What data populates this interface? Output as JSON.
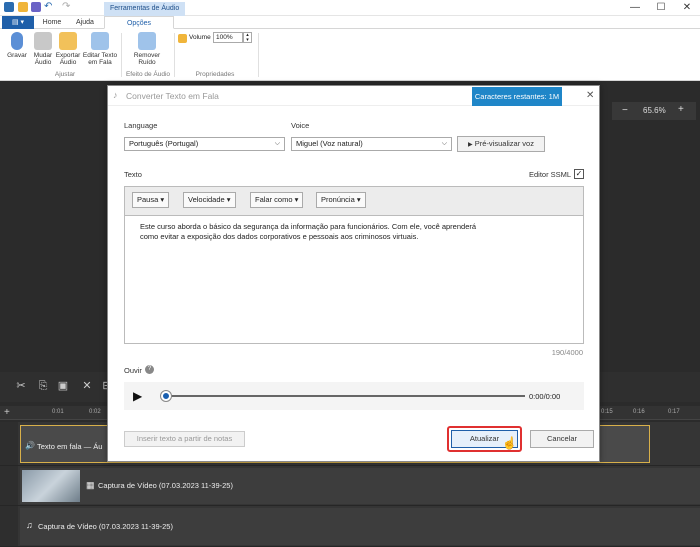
{
  "titlebar": {
    "contextual_tab": "Ferramentas de Áudio",
    "window_controls": [
      "—",
      "☐",
      "✕"
    ]
  },
  "ribbon_tabs": [
    "Home",
    "Ajuda",
    "Opções"
  ],
  "ribbon": {
    "adjust_buttons": [
      {
        "label_1": "Gravar",
        "label_2": "",
        "icon": "microphone-icon"
      },
      {
        "label_1": "Mudar",
        "label_2": "Áudio",
        "icon": "speaker-icon"
      },
      {
        "label_1": "Exportar",
        "label_2": "Áudio",
        "icon": "export-audio-icon"
      },
      {
        "label_1": "Editar Texto",
        "label_2": "em Fala",
        "icon": "edit-tts-icon"
      }
    ],
    "adjust_group_label": "Ajustar",
    "noise_button": {
      "label_1": "Remover",
      "label_2": "Ruído"
    },
    "effect_group_label": "Efeito de Áudio",
    "volume_label": "Volume",
    "volume_value": "100%",
    "properties_group_label": "Propriedades"
  },
  "preview": {
    "zoom_minus": "−",
    "zoom_value": "65.6%",
    "zoom_plus": "+"
  },
  "dialog": {
    "title": "Converter Texto em Fala",
    "chars_remaining": "Caracteres restantes: 1M",
    "close": "✕",
    "language_label": "Language",
    "language_value": "Português (Portugal)",
    "voice_label": "Voice",
    "voice_value": "Miguel (Voz natural)",
    "preview_voice_button": "Pré-visualizar voz",
    "text_label": "Texto",
    "ssml_label": "Editor SSML",
    "ssml_checked": true,
    "editor_buttons": [
      "Pausa",
      "Velocidade",
      "Falar como",
      "Pronúncia"
    ],
    "text_line_1": "Este curso aborda o básico da segurança da informação para funcionários. Com ele, você aprenderá",
    "text_line_2": "como evitar a exposição dos dados corporativos e pessoais aos criminosos virtuais.",
    "char_count": "190/4000",
    "listen_label": "Ouvir",
    "time_display": "0:00/0:00",
    "insert_notes_button": "Inserir texto a partir de notas",
    "update_button": "Atualizar",
    "cancel_button": "Cancelar"
  },
  "timeline": {
    "ruler_ticks": [
      "0:01",
      "0:02",
      "0:15",
      "0:16",
      "0:17"
    ],
    "tracks": [
      {
        "label": "Texto em fala — Áu"
      },
      {
        "label": "Captura de Vídeo (07.03.2023 11-39-25)"
      },
      {
        "label": "Captura de Vídeo (07.03.2023 11-39-25)"
      }
    ]
  },
  "colors": {
    "accent": "#1f86c8",
    "file_tab": "#1f5fa9",
    "update_border": "#e03030",
    "workspace": "#2b2b2b",
    "audio_clip_border": "#d8b04a"
  }
}
